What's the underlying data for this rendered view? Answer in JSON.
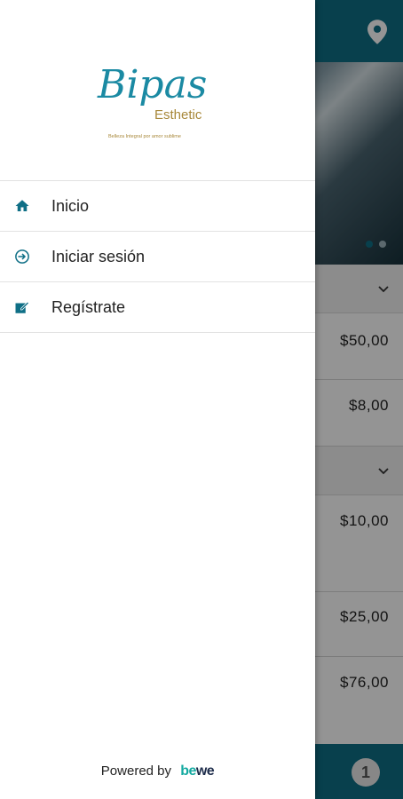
{
  "drawer": {
    "logo": {
      "name": "Bipas",
      "sub": "Esthetic",
      "tagline": "Belleza Integral por amor sublime"
    },
    "menu": [
      {
        "label": "Inicio",
        "icon": "home-icon"
      },
      {
        "label": "Iniciar sesión",
        "icon": "login-icon"
      },
      {
        "label": "Regístrate",
        "icon": "register-icon"
      }
    ],
    "footer": {
      "powered_by": "Powered by",
      "brand_be": "be",
      "brand_we": "we"
    }
  },
  "background": {
    "prices": [
      "$50,00",
      "$8,00",
      "$10,00",
      "$25,00",
      "$76,00"
    ],
    "cart_count": "1"
  },
  "colors": {
    "accent": "#0f6f86",
    "brand_gold": "#a8883a"
  }
}
